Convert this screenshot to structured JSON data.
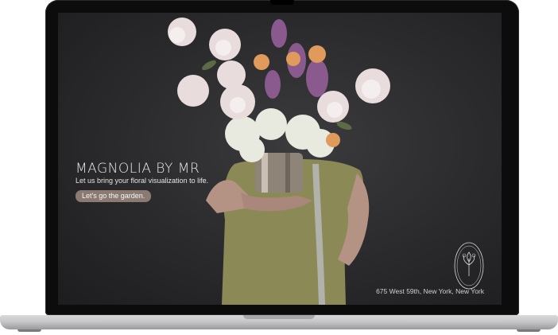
{
  "hero": {
    "brand": "MAGNOLIA BY MR",
    "tagline": "Let us bring your floral visualization to life.",
    "cta_label": "Let's go the garden.",
    "address": "675 West 59th, New York, New York"
  },
  "logo": {
    "ring_text": "MAGNOLIA BY MR"
  },
  "colors": {
    "background": "#2a2a2c",
    "cta": "#8b7a72",
    "text": "#f2f2f2"
  }
}
